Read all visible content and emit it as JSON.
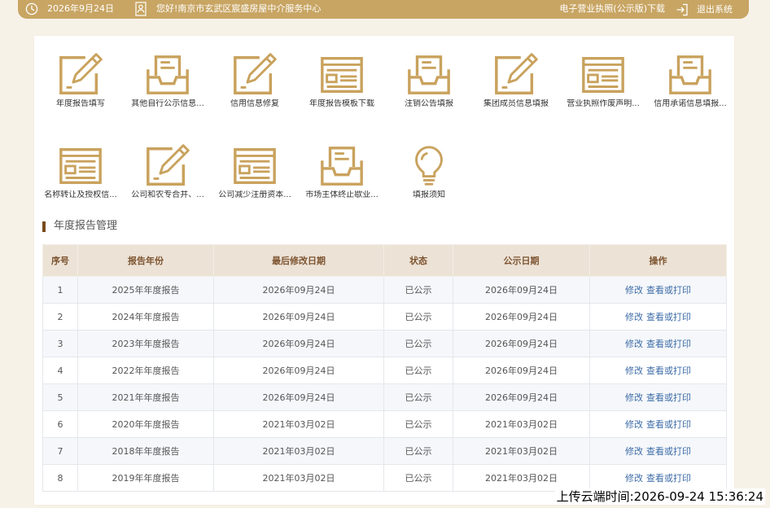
{
  "colors": {
    "accent": "#c9a25d",
    "header_bg": "#c8a563",
    "page_bg": "#f7f2e8",
    "table_header_bg": "#ece2d6",
    "table_header_text": "#7d5430",
    "link": "#3d6ca8",
    "section_bar": "#7a4a1c",
    "row_alt_bg": "#f5f7fa"
  },
  "header": {
    "date_icon": "clock-icon",
    "date": "2026年9月24日",
    "greeting_icon": "user-card-icon",
    "greeting": "您好!南京市玄武区宸盛房屋中介服务中心",
    "license_download": "电子营业执照(公示版)下载",
    "logout_icon": "logout-icon",
    "logout": "退出系统"
  },
  "menu": [
    {
      "label": "年度报告填写",
      "icon": "edit-icon"
    },
    {
      "label": "其他自行公示信息...",
      "icon": "inbox-icon"
    },
    {
      "label": "信用信息修复",
      "icon": "edit-icon"
    },
    {
      "label": "年度报告模板下载",
      "icon": "form-icon"
    },
    {
      "label": "注销公告填报",
      "icon": "inbox-icon"
    },
    {
      "label": "集团成员信息填报",
      "icon": "edit-icon"
    },
    {
      "label": "营业执照作废声明...",
      "icon": "form-icon"
    },
    {
      "label": "信用承诺信息填报...",
      "icon": "inbox-icon"
    },
    {
      "label": "名称转让及授权信...",
      "icon": "form-icon"
    },
    {
      "label": "公司和农专合并、...",
      "icon": "edit-icon"
    },
    {
      "label": "公司减少注册资本...",
      "icon": "form-icon"
    },
    {
      "label": "市场主体终止歇业...",
      "icon": "inbox-icon"
    },
    {
      "label": "填报须知",
      "icon": "lightbulb-icon"
    }
  ],
  "section_title": "年度报告管理",
  "table": {
    "columns": [
      "序号",
      "报告年份",
      "最后修改日期",
      "状态",
      "公示日期",
      "操作"
    ],
    "rows": [
      {
        "no": "1",
        "year": "2025年年度报告",
        "modified": "2026年09月24日",
        "status": "已公示",
        "published": "2026年09月24日",
        "edit": "修改",
        "view": "查看或打印"
      },
      {
        "no": "2",
        "year": "2024年年度报告",
        "modified": "2026年09月24日",
        "status": "已公示",
        "published": "2026年09月24日",
        "edit": "修改",
        "view": "查看或打印"
      },
      {
        "no": "3",
        "year": "2023年年度报告",
        "modified": "2026年09月24日",
        "status": "已公示",
        "published": "2026年09月24日",
        "edit": "修改",
        "view": "查看或打印"
      },
      {
        "no": "4",
        "year": "2022年年度报告",
        "modified": "2026年09月24日",
        "status": "已公示",
        "published": "2026年09月24日",
        "edit": "修改",
        "view": "查看或打印"
      },
      {
        "no": "5",
        "year": "2021年年度报告",
        "modified": "2026年09月24日",
        "status": "已公示",
        "published": "2026年09月24日",
        "edit": "修改",
        "view": "查看或打印"
      },
      {
        "no": "6",
        "year": "2020年年度报告",
        "modified": "2021年03月02日",
        "status": "已公示",
        "published": "2021年03月02日",
        "edit": "修改",
        "view": "查看或打印"
      },
      {
        "no": "7",
        "year": "2018年年度报告",
        "modified": "2021年03月02日",
        "status": "已公示",
        "published": "2021年03月02日",
        "edit": "修改",
        "view": "查看或打印"
      },
      {
        "no": "8",
        "year": "2019年年度报告",
        "modified": "2021年03月02日",
        "status": "已公示",
        "published": "2021年03月02日",
        "edit": "修改",
        "view": "查看或打印"
      }
    ]
  },
  "upload_time": "上传云端时间:2026-09-24 15:36:24"
}
